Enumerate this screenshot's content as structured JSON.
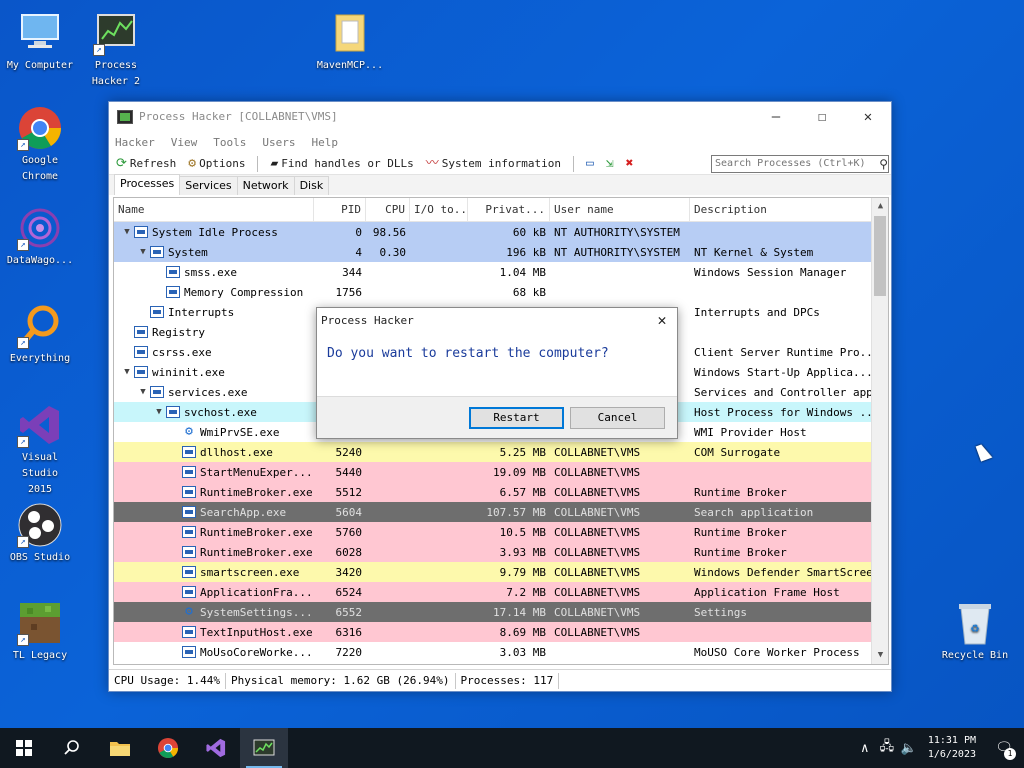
{
  "desktop": {
    "icons": [
      {
        "label": "My Computer",
        "icon": "computer-icon"
      },
      {
        "label": "Process Hacker 2",
        "icon": "process-hacker-icon"
      },
      {
        "label": "MavenMCP...",
        "icon": "folder-icon"
      },
      {
        "label": "Google Chrome",
        "icon": "chrome-icon"
      },
      {
        "label": "DataWago...",
        "icon": "datawago-icon"
      },
      {
        "label": "Everything",
        "icon": "everything-icon"
      },
      {
        "label": "Visual Studio 2015",
        "icon": "visual-studio-icon"
      },
      {
        "label": "OBS Studio",
        "icon": "obs-icon"
      },
      {
        "label": "TL Legacy",
        "icon": "minecraft-icon"
      },
      {
        "label": "Recycle Bin",
        "icon": "recycle-bin-icon"
      }
    ]
  },
  "window": {
    "title": "Process Hacker [COLLABNET\\VMS]",
    "controls": {
      "minimize": "—",
      "maximize": "☐",
      "close": "✕"
    },
    "menu": [
      "Hacker",
      "View",
      "Tools",
      "Users",
      "Help"
    ],
    "toolbar": {
      "refresh": "Refresh",
      "options": "Options",
      "find_handles": "Find handles or DLLs",
      "system_info": "System information"
    },
    "search": {
      "placeholder": "Search Processes (Ctrl+K)"
    },
    "tabs": [
      "Processes",
      "Services",
      "Network",
      "Disk"
    ],
    "columns": [
      "Name",
      "PID",
      "CPU",
      "I/O to...",
      "Privat...",
      "User name",
      "Description"
    ],
    "rows": [
      {
        "indent": 0,
        "chev": "v",
        "name": "System Idle Process",
        "pid": "0",
        "cpu": "98.56",
        "io": "",
        "priv": "60 kB",
        "user": "NT AUTHORITY\\SYSTEM",
        "desc": "",
        "bg": "blue"
      },
      {
        "indent": 1,
        "chev": "v",
        "name": "System",
        "pid": "4",
        "cpu": "0.30",
        "io": "",
        "priv": "196 kB",
        "user": "NT AUTHORITY\\SYSTEM",
        "desc": "NT Kernel & System",
        "bg": "blue"
      },
      {
        "indent": 2,
        "chev": "",
        "name": "smss.exe",
        "pid": "344",
        "cpu": "",
        "io": "",
        "priv": "1.04 MB",
        "user": "",
        "desc": "Windows Session Manager",
        "bg": ""
      },
      {
        "indent": 2,
        "chev": "",
        "name": "Memory Compression",
        "pid": "1756",
        "cpu": "",
        "io": "",
        "priv": "68 kB",
        "user": "",
        "desc": "",
        "bg": ""
      },
      {
        "indent": 1,
        "chev": "",
        "name": "Interrupts",
        "pid": "",
        "cpu": "",
        "io": "",
        "priv": "",
        "user": "",
        "desc": "Interrupts and DPCs",
        "bg": ""
      },
      {
        "indent": 0,
        "chev": "",
        "name": "Registry",
        "pid": "",
        "cpu": "",
        "io": "",
        "priv": "",
        "user": "",
        "desc": "",
        "bg": ""
      },
      {
        "indent": 0,
        "chev": "",
        "name": "csrss.exe",
        "pid": "",
        "cpu": "",
        "io": "",
        "priv": "",
        "user": "",
        "desc": "Client Server Runtime Pro...",
        "bg": ""
      },
      {
        "indent": 0,
        "chev": "v",
        "name": "wininit.exe",
        "pid": "",
        "cpu": "",
        "io": "",
        "priv": "",
        "user": "",
        "desc": "Windows Start-Up Applica...",
        "bg": ""
      },
      {
        "indent": 1,
        "chev": "v",
        "name": "services.exe",
        "pid": "",
        "cpu": "",
        "io": "",
        "priv": "",
        "user": "",
        "desc": "Services and Controller app",
        "bg": ""
      },
      {
        "indent": 2,
        "chev": "v",
        "name": "svchost.exe",
        "pid": "",
        "cpu": "",
        "io": "",
        "priv": "",
        "user": "",
        "desc": "Host Process for Windows ...",
        "bg": "cyan"
      },
      {
        "indent": 3,
        "chev": "",
        "name": "WmiPrvSE.exe",
        "pid": "",
        "cpu": "",
        "io": "",
        "priv": "",
        "user": "",
        "desc": "WMI Provider Host",
        "bg": "",
        "icon": "gear"
      },
      {
        "indent": 3,
        "chev": "",
        "name": "dllhost.exe",
        "pid": "5240",
        "cpu": "",
        "io": "",
        "priv": "5.25 MB",
        "user": "COLLABNET\\VMS",
        "desc": "COM Surrogate",
        "bg": "yellow"
      },
      {
        "indent": 3,
        "chev": "",
        "name": "StartMenuExper...",
        "pid": "5440",
        "cpu": "",
        "io": "",
        "priv": "19.09 MB",
        "user": "COLLABNET\\VMS",
        "desc": "",
        "bg": "pink"
      },
      {
        "indent": 3,
        "chev": "",
        "name": "RuntimeBroker.exe",
        "pid": "5512",
        "cpu": "",
        "io": "",
        "priv": "6.57 MB",
        "user": "COLLABNET\\VMS",
        "desc": "Runtime Broker",
        "bg": "pink"
      },
      {
        "indent": 3,
        "chev": "",
        "name": "SearchApp.exe",
        "pid": "5604",
        "cpu": "",
        "io": "",
        "priv": "107.57 MB",
        "user": "COLLABNET\\VMS",
        "desc": "Search application",
        "bg": "dark"
      },
      {
        "indent": 3,
        "chev": "",
        "name": "RuntimeBroker.exe",
        "pid": "5760",
        "cpu": "",
        "io": "",
        "priv": "10.5 MB",
        "user": "COLLABNET\\VMS",
        "desc": "Runtime Broker",
        "bg": "pink"
      },
      {
        "indent": 3,
        "chev": "",
        "name": "RuntimeBroker.exe",
        "pid": "6028",
        "cpu": "",
        "io": "",
        "priv": "3.93 MB",
        "user": "COLLABNET\\VMS",
        "desc": "Runtime Broker",
        "bg": "pink"
      },
      {
        "indent": 3,
        "chev": "",
        "name": "smartscreen.exe",
        "pid": "3420",
        "cpu": "",
        "io": "",
        "priv": "9.79 MB",
        "user": "COLLABNET\\VMS",
        "desc": "Windows Defender SmartScreen",
        "bg": "yellow"
      },
      {
        "indent": 3,
        "chev": "",
        "name": "ApplicationFra...",
        "pid": "6524",
        "cpu": "",
        "io": "",
        "priv": "7.2 MB",
        "user": "COLLABNET\\VMS",
        "desc": "Application Frame Host",
        "bg": "pink"
      },
      {
        "indent": 3,
        "chev": "",
        "name": "SystemSettings...",
        "pid": "6552",
        "cpu": "",
        "io": "",
        "priv": "17.14 MB",
        "user": "COLLABNET\\VMS",
        "desc": "Settings",
        "bg": "dark",
        "icon": "gear"
      },
      {
        "indent": 3,
        "chev": "",
        "name": "TextInputHost.exe",
        "pid": "6316",
        "cpu": "",
        "io": "",
        "priv": "8.69 MB",
        "user": "COLLABNET\\VMS",
        "desc": "",
        "bg": "pink"
      },
      {
        "indent": 3,
        "chev": "",
        "name": "MoUsoCoreWorke...",
        "pid": "7220",
        "cpu": "",
        "io": "",
        "priv": "3.03 MB",
        "user": "",
        "desc": "MoUSO Core Worker Process",
        "bg": ""
      }
    ],
    "status": {
      "cpu": "CPU Usage: 1.44%",
      "memory": "Physical memory: 1.62 GB (26.94%)",
      "processes": "Processes: 117"
    }
  },
  "dialog": {
    "title": "Process Hacker",
    "message": "Do you want to restart the computer?",
    "restart": "Restart",
    "cancel": "Cancel"
  },
  "taskbar": {
    "time": "11:31 PM",
    "date": "1/6/2023",
    "notifications": "1"
  },
  "colors": {
    "row_blue": "#b7cdf4",
    "row_cyan": "#c8f6fb",
    "row_yellow": "#fdf9ac",
    "row_pink": "#ffc7d2",
    "row_dark": "#6e6e6e",
    "dialog_text": "#1a3b9b",
    "accent": "#0078d7"
  }
}
